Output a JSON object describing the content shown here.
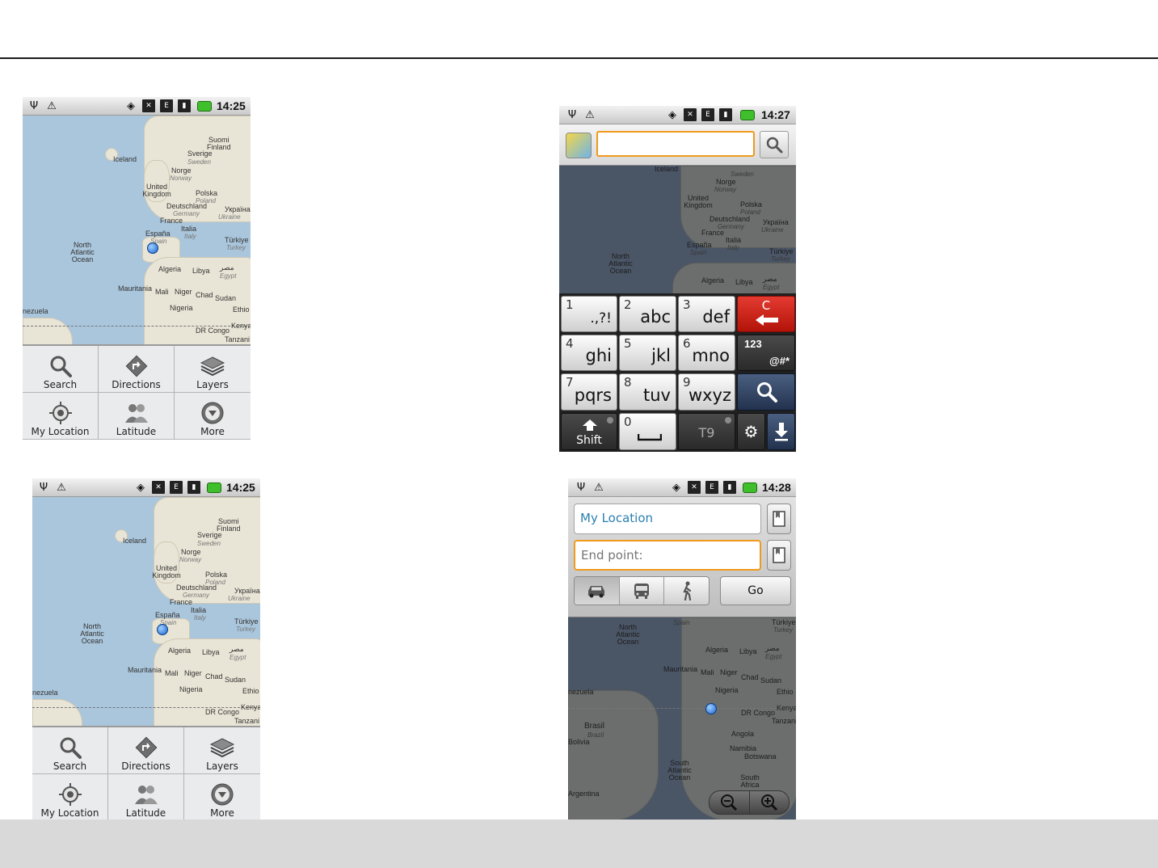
{
  "status_bar": {
    "screen1_time": "14:25",
    "screen2_time": "14:27",
    "screen3_time": "14:25",
    "screen4_time": "14:28",
    "icons": [
      "usb-icon",
      "warning-icon",
      "gps-icon",
      "mute-icon",
      "network-e-icon",
      "signal-2g-icon",
      "battery-icon"
    ]
  },
  "map_labels": {
    "suomi": "Suomi",
    "finland": "Finland",
    "iceland": "Iceland",
    "sverige": "Sverige",
    "sweden": "Sweden",
    "norge": "Norge",
    "norway": "Norway",
    "united_kingdom": "United Kingdom",
    "polska": "Polska",
    "poland": "Poland",
    "deutschland": "Deutschland",
    "germany": "Germany",
    "ukraina_native": "Україна",
    "ukraine": "Ukraine",
    "france": "France",
    "italia": "Italia",
    "italy": "Italy",
    "espana": "España",
    "spain": "Spain",
    "turkiye": "Türkiye",
    "turkey": "Turkey",
    "north_atlantic": "North Atlantic Ocean",
    "south_atlantic": "South Atlantic Ocean",
    "algeria": "Algeria",
    "libya": "Libya",
    "egypt_native": "مصر",
    "egypt": "Egypt",
    "mauritania": "Mauritania",
    "mali": "Mali",
    "niger": "Niger",
    "chad": "Chad",
    "sudan": "Sudan",
    "nigeria": "Nigeria",
    "ethiopia": "Ethio",
    "venezuela": "nezuela",
    "dr_congo": "DR Congo",
    "kenya": "Kenya",
    "tanzania": "Tanzani",
    "brasil": "Brasil",
    "brazil": "Brazil",
    "bolivia": "Bolivia",
    "angola": "Angola",
    "namibia": "Namibia",
    "botswana": "Botswana",
    "south_africa": "South Africa",
    "argentina": "Argentina"
  },
  "menu": {
    "search": "Search",
    "directions": "Directions",
    "layers": "Layers",
    "my_location": "My Location",
    "latitude": "Latitude",
    "more": "More"
  },
  "search": {
    "value": ""
  },
  "keyboard": {
    "row1": [
      {
        "digit": "1",
        "label": ".,?!"
      },
      {
        "digit": "2",
        "label": "abc"
      },
      {
        "digit": "3",
        "label": "def"
      }
    ],
    "row2": [
      {
        "digit": "4",
        "label": "ghi"
      },
      {
        "digit": "5",
        "label": "jkl"
      },
      {
        "digit": "6",
        "label": "mno"
      }
    ],
    "row3": [
      {
        "digit": "7",
        "label": "pqrs"
      },
      {
        "digit": "8",
        "label": "tuv"
      },
      {
        "digit": "9",
        "label": "wxyz"
      }
    ],
    "clear_label": "C",
    "symbols_top": "123",
    "symbols_bottom": "@#*",
    "shift_label": "Shift",
    "zero_digit": "0",
    "t9_label": "T9"
  },
  "directions": {
    "from_value": "My Location",
    "to_placeholder": "End point:",
    "go_label": "Go",
    "modes": [
      "car-icon",
      "bus-icon",
      "walk-icon"
    ],
    "selected_mode": "car"
  },
  "colors": {
    "accent_orange": "#f09a1c",
    "delete_red": "#c8261b",
    "search_key_blue": "#2f4263",
    "location_blue": "#2a7fb0"
  }
}
